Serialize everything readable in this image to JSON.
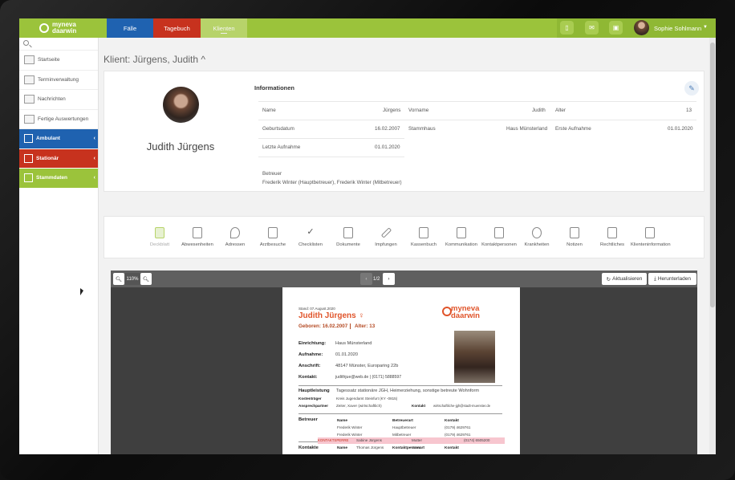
{
  "app": {
    "logo_line1": "myneva",
    "logo_line2": "daarwin",
    "user_name": "Sophie Sohlmann"
  },
  "nav_tabs": [
    {
      "label": "Fälle"
    },
    {
      "label": "Tagebuch"
    },
    {
      "label": "Klienten"
    }
  ],
  "top_icons": [
    "phone-icon",
    "mail-icon",
    "calendar-icon"
  ],
  "sidebar": {
    "items": [
      {
        "label": "Startseite",
        "icon": "home-icon"
      },
      {
        "label": "Terminverwaltung",
        "icon": "calendar-icon"
      },
      {
        "label": "Nachrichten",
        "icon": "mail-icon"
      },
      {
        "label": "Fertige Auswertungen",
        "icon": "report-icon"
      }
    ],
    "categories": [
      {
        "label": "Ambulant",
        "color": "#1f62b0"
      },
      {
        "label": "Stationär",
        "color": "#c7321e"
      },
      {
        "label": "Stammdaten",
        "color": "#9bc33b"
      }
    ]
  },
  "page": {
    "title": "Klient: Jürgens, Judith",
    "title_caret": "^"
  },
  "client": {
    "full_name": "Judith Jürgens",
    "section_title": "Informationen",
    "fields": {
      "name_label": "Name",
      "name_value": "Jürgens",
      "vorname_label": "Vorname",
      "vorname_value": "Judith",
      "alter_label": "Alter",
      "alter_value": "13",
      "geb_label": "Geburtsdatum",
      "geb_value": "16.02.2007",
      "stammhaus_label": "Stammhaus",
      "stammhaus_value": "Haus Münsterland",
      "erste_label": "Erste Aufnahme",
      "erste_value": "01.01.2020",
      "letzte_label": "Letzte Aufnahme",
      "letzte_value": "01.01.2020"
    },
    "betreuer_label": "Betreuer",
    "betreuer_value": "Frederik Winter (Hauptbetreuer), Frederik Winter (Mitbetreuer)"
  },
  "toolbar": [
    {
      "label": "Deckblatt",
      "disabled": true
    },
    {
      "label": "Abwesenheiten"
    },
    {
      "label": "Adressen"
    },
    {
      "label": "Arztbesuche"
    },
    {
      "label": "Checklisten"
    },
    {
      "label": "Dokumente"
    },
    {
      "label": "Impfungen"
    },
    {
      "label": "Kassenbuch"
    },
    {
      "label": "Kommunikation"
    },
    {
      "label": "Kontaktpersonen"
    },
    {
      "label": "Krankheiten"
    },
    {
      "label": "Notizen"
    },
    {
      "label": "Rechtliches"
    },
    {
      "label": "Klienteninformation"
    }
  ],
  "viewer": {
    "zoom": "110%",
    "page": "1/2",
    "refresh_label": "Aktualisieren",
    "download_label": "Herunterladen"
  },
  "doc": {
    "stand": "Stand: 07.August.2020",
    "name": "Judith Jürgens ♀",
    "geboren": "Geboren: 16.02.2007",
    "alter": "Alter:  13",
    "logo1": "myneva",
    "logo2": "daarwin",
    "rows": [
      {
        "label": "Einrichtung:",
        "value": "Haus Münsterland"
      },
      {
        "label": "Aufnahme:",
        "value": "01.01.2020"
      },
      {
        "label": "Anschrift:",
        "value": "48147 Münster, Europaring 22b"
      },
      {
        "label": "Kontakt:",
        "value": "judithjue@web.de | (0171) 5888597"
      }
    ],
    "hauptleistung_label": "Hauptleistung",
    "hauptleistung_value": "Tagessatz stationäre JGH, Heimerziehung, sonstige betreute Wohnform",
    "kostentraeger_label": "Kostenträger",
    "kostentraeger_value": "Kreis Jugendamt Steinfurt (KY -0815)",
    "ansprech_label": "Ansprechpartner",
    "ansprech_value": "Zeiter, Xaver  (wirtschaftlich)",
    "kontakt_label": "Kontakt",
    "kontakt_value": "wirtschaftliche-jgh@stadt-muenster.de",
    "betreuer_title": "Betreuer",
    "betreuer_headers": [
      "Name",
      "Betreuerart",
      "Kontakt"
    ],
    "betreuer_rows": [
      [
        "Frederik Winter",
        "Hauptbetreuer",
        "(0179) 4629761"
      ],
      [
        "Frederik Winter",
        "Mitbetreuer",
        "(0179) 4629761"
      ]
    ],
    "kontakte_title": "Kontakte",
    "kontakte_headers": [
      "Name",
      "Kontaktpersonart",
      "Kontakt"
    ],
    "kontaktsperre": "KONTAKTSPERRE",
    "kontakte_rows": [
      [
        "Sabine Jürgens",
        "Mutter",
        "(0174) 6505200"
      ],
      [
        "Thomas Jürgens",
        "Vater",
        ""
      ]
    ]
  }
}
